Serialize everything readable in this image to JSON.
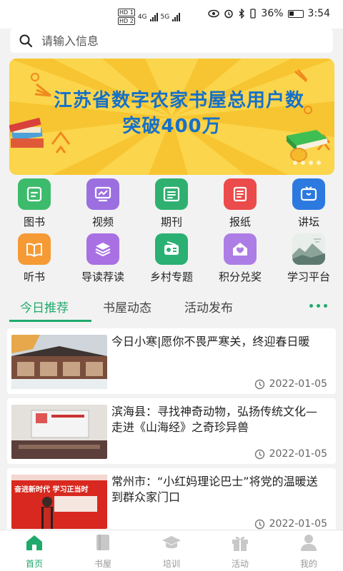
{
  "status_bar": {
    "hd1": "HD 1",
    "hd2": "HD 2",
    "net1": "4G",
    "net2": "5G",
    "battery": "36%",
    "time": "3:54"
  },
  "search": {
    "placeholder": "请输入信息"
  },
  "banner": {
    "line1": "江苏省数字农家书屋总用户数",
    "line2": "突破400万"
  },
  "categories": [
    {
      "label": "图书",
      "icon": "book-icon",
      "color": "#3dbb6c"
    },
    {
      "label": "视频",
      "icon": "video-icon",
      "color": "#9b6fe0"
    },
    {
      "label": "期刊",
      "icon": "journal-icon",
      "color": "#2fb070"
    },
    {
      "label": "报纸",
      "icon": "newspaper-icon",
      "color": "#ec4b4b"
    },
    {
      "label": "讲坛",
      "icon": "tv-icon",
      "color": "#2c79e0"
    },
    {
      "label": "听书",
      "icon": "audiobook-icon",
      "color": "#f59a34"
    },
    {
      "label": "导读荐读",
      "icon": "stack-icon",
      "color": "#a970e3"
    },
    {
      "label": "乡村专题",
      "icon": "radio-icon",
      "color": "#2ab073"
    },
    {
      "label": "积分兑奖",
      "icon": "heart-house-icon",
      "color": "#ad7de6"
    },
    {
      "label": "学习平台",
      "icon": "landscape-icon",
      "color": "#9fb0a8"
    }
  ],
  "tabs": [
    {
      "label": "今日推荐"
    },
    {
      "label": "书屋动态"
    },
    {
      "label": "活动发布"
    }
  ],
  "articles": [
    {
      "title": "今日小寒|愿你不畏严寒关，终迎春日暖",
      "date": "2022-01-05"
    },
    {
      "title": "滨海县：寻找神奇动物，弘扬传统文化—走进《山海经》之奇珍异兽",
      "date": "2022-01-05"
    },
    {
      "title": "常州市：“小红妈理论巴士”将党的温暖送到群众家门口",
      "date": "2022-01-05"
    }
  ],
  "thumb3_text": "奋进新时代  学习正当时",
  "nav": [
    {
      "label": "首页"
    },
    {
      "label": "书屋"
    },
    {
      "label": "培训"
    },
    {
      "label": "活动"
    },
    {
      "label": "我的"
    }
  ],
  "colors": {
    "accent": "#1faa6b",
    "banner_bg": "#fbd54b",
    "banner_text": "#1670c8"
  }
}
